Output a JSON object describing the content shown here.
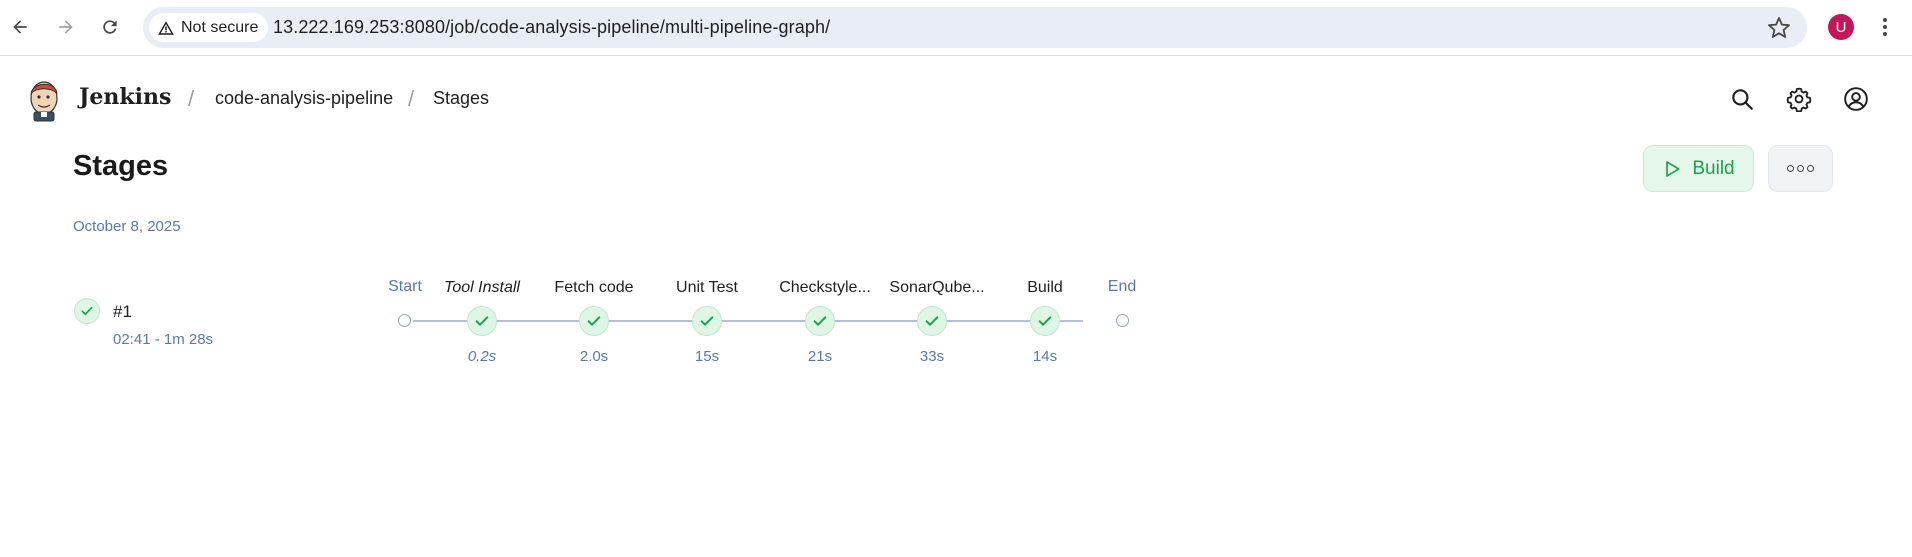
{
  "browser": {
    "security_label": "Not secure",
    "url": "13.222.169.253:8080/job/code-analysis-pipeline/multi-pipeline-graph/",
    "profile_initial": "U"
  },
  "header": {
    "app_name": "Jenkins",
    "breadcrumbs": [
      "code-analysis-pipeline",
      "Stages"
    ]
  },
  "page": {
    "title": "Stages",
    "build_label": "Build",
    "date": "October 8, 2025"
  },
  "run": {
    "id": "#1",
    "time": "02:41 - 1m 28s",
    "status": "success"
  },
  "pipeline": {
    "start_label": "Start",
    "end_label": "End",
    "stages": [
      {
        "name": "Tool Install",
        "duration": "0.2s",
        "italic": true
      },
      {
        "name": "Fetch code",
        "duration": "2.0s",
        "italic": false
      },
      {
        "name": "Unit Test",
        "duration": "15s",
        "italic": false
      },
      {
        "name": "Checkstyle...",
        "duration": "21s",
        "italic": false
      },
      {
        "name": "SonarQube...",
        "duration": "33s",
        "italic": false
      },
      {
        "name": "Build",
        "duration": "14s",
        "italic": false
      }
    ]
  },
  "colors": {
    "success_green": "#1aa34a",
    "accent_blue": "#5b7aa8",
    "avatar": "#c2185b"
  }
}
